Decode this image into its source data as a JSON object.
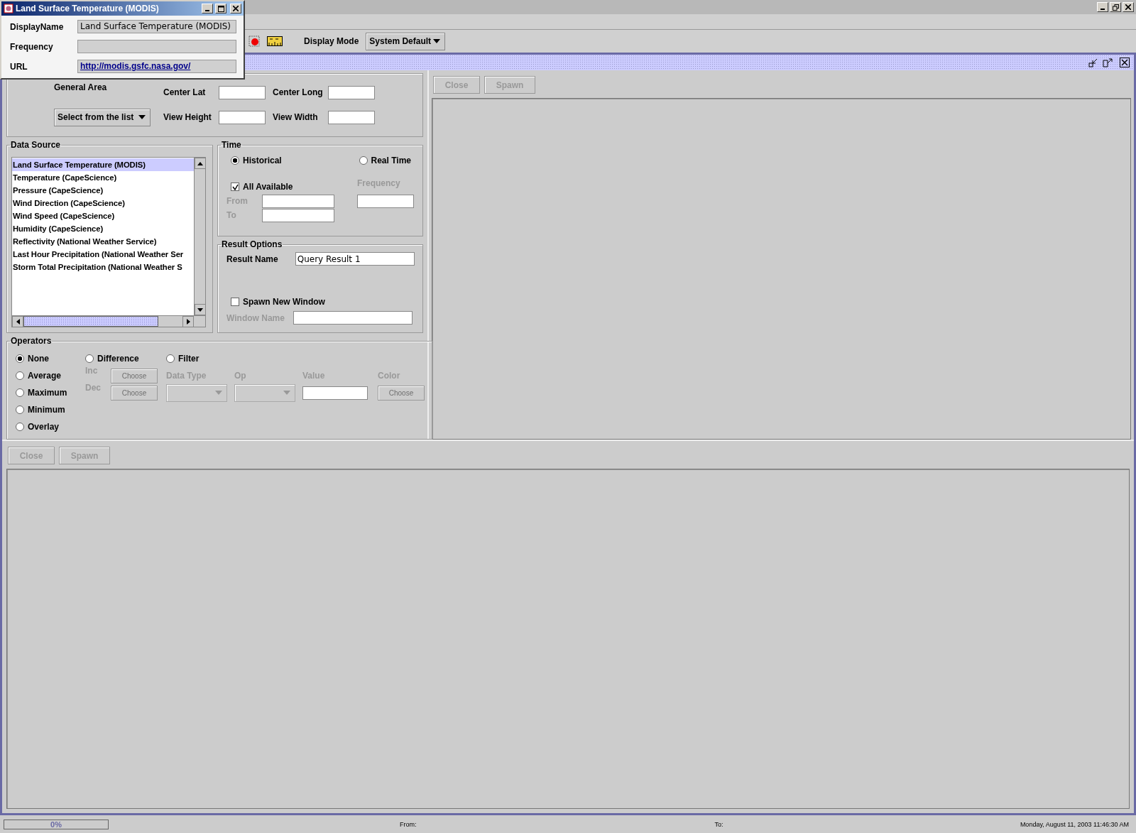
{
  "popup": {
    "title": "Land Surface Temperature (MODIS)",
    "fields": [
      {
        "label": "DisplayName",
        "value": "Land Surface Temperature (MODIS)",
        "kind": "text"
      },
      {
        "label": "Frequency",
        "kind": "text"
      },
      {
        "label": "URL",
        "value": "http://modis.gsfc.nasa.gov/",
        "kind": "link"
      }
    ]
  },
  "toolbar": {
    "display_mode_label": "Display Mode",
    "display_mode_value": "System Default"
  },
  "location": {
    "general_area_label": "General Area",
    "general_area_value": "Select from the list",
    "fields": [
      {
        "label": "Center Lat"
      },
      {
        "label": "Center Long"
      },
      {
        "label": "View Height"
      },
      {
        "label": "View Width"
      }
    ]
  },
  "data_source": {
    "title": "Data Source",
    "items": [
      {
        "label": "Land Surface Temperature (MODIS)",
        "selected": true
      },
      {
        "label": "Temperature (CapeScience)",
        "selected": false
      },
      {
        "label": "Pressure (CapeScience)",
        "selected": false
      },
      {
        "label": "Wind Direction (CapeScience)",
        "selected": false
      },
      {
        "label": "Wind Speed (CapeScience)",
        "selected": false
      },
      {
        "label": "Humidity (CapeScience)",
        "selected": false
      },
      {
        "label": "Reflectivity (National Weather Service)",
        "selected": false
      },
      {
        "label": "Last Hour Precipitation (National Weather Ser",
        "selected": false
      },
      {
        "label": "Storm Total Precipitation (National Weather S",
        "selected": false
      }
    ]
  },
  "time": {
    "title": "Time",
    "modes": [
      {
        "label": "Historical",
        "selected": true
      },
      {
        "label": "Real Time",
        "selected": false
      }
    ],
    "all_available": {
      "label": "All Available",
      "checked": true
    },
    "frequency_label": "Frequency",
    "from_label": "From",
    "to_label": "To"
  },
  "result_options": {
    "title": "Result Options",
    "result_name_label": "Result Name",
    "result_name_value": "Query Result 1",
    "spawn_new_window": {
      "label": "Spawn New Window",
      "checked": false
    },
    "window_name_label": "Window Name"
  },
  "operators": {
    "title": "Operators",
    "options": [
      {
        "label": "None",
        "selected": true
      },
      {
        "label": "Difference",
        "selected": false
      },
      {
        "label": "Filter",
        "selected": false
      },
      {
        "label": "Average",
        "selected": false
      },
      {
        "label": "Maximum",
        "selected": false
      },
      {
        "label": "Minimum",
        "selected": false
      },
      {
        "label": "Overlay",
        "selected": false
      }
    ],
    "inc_label": "Inc",
    "dec_label": "Dec",
    "choose_buttons": [
      "Choose",
      "Choose",
      "Choose"
    ],
    "data_type_label": "Data Type",
    "op_label": "Op",
    "value_label": "Value",
    "color_label": "Color"
  },
  "result_panel": {
    "buttons": [
      "Close",
      "Spawn"
    ]
  },
  "bottom_panel": {
    "buttons": [
      "Close",
      "Spawn"
    ]
  },
  "status_bar": {
    "progress": {
      "level": 0,
      "text": "0%"
    },
    "from": "From:",
    "to": "To:",
    "datetime": "Monday, August 11, 2003 11:46:30 AM"
  }
}
